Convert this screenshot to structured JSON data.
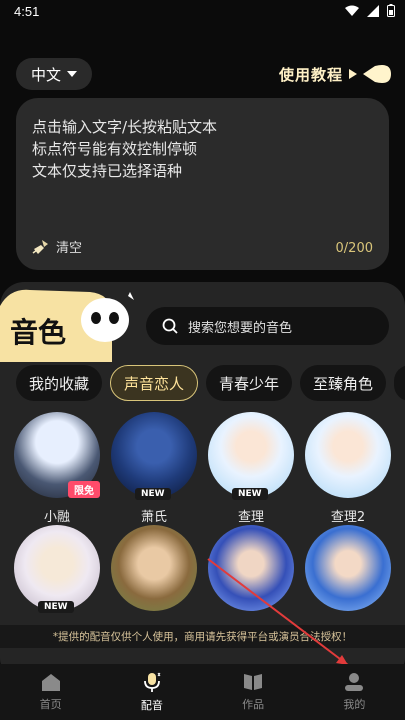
{
  "status_bar": {
    "time": "4:51"
  },
  "header": {
    "language": "中文",
    "tutorial_label": "使用教程"
  },
  "editor": {
    "placeholder_lines": [
      "点击输入文字/长按粘贴文本",
      "标点符号能有效控制停顿",
      "文本仅支持已选择语种"
    ],
    "clear_label": "清空",
    "char_count": "0/200"
  },
  "voice_section": {
    "title": "音色",
    "search_placeholder": "搜索您想要的音色",
    "tabs": [
      "我的收藏",
      "声音恋人",
      "青春少年",
      "至臻角色"
    ],
    "active_tab_index": 1,
    "voices": [
      {
        "name": "小融",
        "tag": "限免",
        "palette": [
          "#cfe0ff",
          "#29303f"
        ]
      },
      {
        "name": "萧氏",
        "tag": "NEW",
        "palette": [
          "#1f3b7a",
          "#0a1430"
        ]
      },
      {
        "name": "查理",
        "tag": "NEW",
        "palette": [
          "#a9d6f5",
          "#e9f3ff"
        ]
      },
      {
        "name": "查理2",
        "tag": "",
        "palette": [
          "#a9d6f5",
          "#e9f3ff"
        ]
      },
      {
        "name": "",
        "tag": "NEW",
        "palette": [
          "#efe9f2",
          "#b9aebf"
        ]
      },
      {
        "name": "",
        "tag": "",
        "palette": [
          "#6f8a4a",
          "#d8c89a"
        ]
      },
      {
        "name": "",
        "tag": "",
        "palette": [
          "#3550b8",
          "#8fb3ff"
        ]
      },
      {
        "name": "",
        "tag": "",
        "palette": [
          "#3a6fd1",
          "#9ec9ff"
        ]
      }
    ]
  },
  "disclaimer": "*提供的配音仅供个人使用，商用请先获得平台或演员合法授权！",
  "bottom_nav": [
    {
      "label": "首页",
      "icon": "home-icon"
    },
    {
      "label": "配音",
      "icon": "microphone-icon"
    },
    {
      "label": "作品",
      "icon": "book-icon"
    },
    {
      "label": "我的",
      "icon": "profile-icon"
    }
  ],
  "active_nav_index": 1,
  "colors": {
    "accent": "#ffe39a",
    "tag_limited": "#ff4b6a",
    "panel": "#252525"
  }
}
